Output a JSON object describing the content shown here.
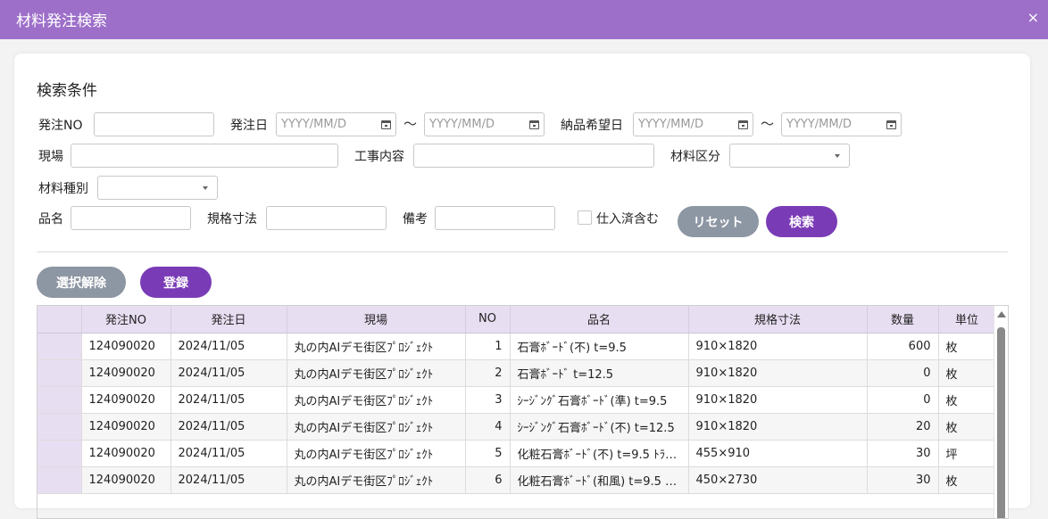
{
  "window": {
    "title": "材料発注検索",
    "close_label": "×"
  },
  "search": {
    "section_title": "検索条件",
    "order_no_label": "発注NO",
    "order_date_label": "発注日",
    "date_placeholder": "YYYY/MM/D",
    "tilde": "～",
    "delivery_date_label": "納品希望日",
    "site_label": "現場",
    "work_label": "工事内容",
    "material_class_label": "材料区分",
    "material_type_label": "材料種別",
    "item_name_label": "品名",
    "spec_label": "規格寸法",
    "remarks_label": "備考",
    "include_purchased_label": "仕入済含む",
    "reset_label": "リセット",
    "search_label": "検索"
  },
  "actions": {
    "deselect_label": "選択解除",
    "register_label": "登録"
  },
  "table": {
    "headers": [
      "",
      "発注NO",
      "発注日",
      "現場",
      "NO",
      "品名",
      "規格寸法",
      "数量",
      "単位"
    ],
    "rows": [
      {
        "order_no": "124090020",
        "date": "2024/11/05",
        "site": "丸の内AIデモ街区ﾌﾟﾛｼﾞｪｸﾄ",
        "no": "1",
        "item": "石膏ﾎﾞｰﾄﾞ(不) t=9.5",
        "spec": "910×1820",
        "qty": "600",
        "unit": "枚"
      },
      {
        "order_no": "124090020",
        "date": "2024/11/05",
        "site": "丸の内AIデモ街区ﾌﾟﾛｼﾞｪｸﾄ",
        "no": "2",
        "item": "石膏ﾎﾞｰﾄﾞ t=12.5",
        "spec": "910×1820",
        "qty": "0",
        "unit": "枚"
      },
      {
        "order_no": "124090020",
        "date": "2024/11/05",
        "site": "丸の内AIデモ街区ﾌﾟﾛｼﾞｪｸﾄ",
        "no": "3",
        "item": "ｼｰｼﾞﾝｸﾞ石膏ﾎﾞｰﾄﾞ(準) t=9.5",
        "spec": "910×1820",
        "qty": "0",
        "unit": "枚"
      },
      {
        "order_no": "124090020",
        "date": "2024/11/05",
        "site": "丸の内AIデモ街区ﾌﾟﾛｼﾞｪｸﾄ",
        "no": "4",
        "item": "ｼｰｼﾞﾝｸﾞ石膏ﾎﾞｰﾄﾞ(不) t=12.5",
        "spec": "910×1820",
        "qty": "20",
        "unit": "枚"
      },
      {
        "order_no": "124090020",
        "date": "2024/11/05",
        "site": "丸の内AIデモ街区ﾌﾟﾛｼﾞｪｸﾄ",
        "no": "5",
        "item": "化粧石膏ﾎﾞｰﾄﾞ(不) t=9.5 ﾄﾗ…",
        "spec": "455×910",
        "qty": "30",
        "unit": "坪"
      },
      {
        "order_no": "124090020",
        "date": "2024/11/05",
        "site": "丸の内AIデモ街区ﾌﾟﾛｼﾞｪｸﾄ",
        "no": "6",
        "item": "化粧石膏ﾎﾞｰﾄﾞ(和風) t=9.5 …",
        "spec": "450×2730",
        "qty": "30",
        "unit": "枚"
      }
    ]
  }
}
